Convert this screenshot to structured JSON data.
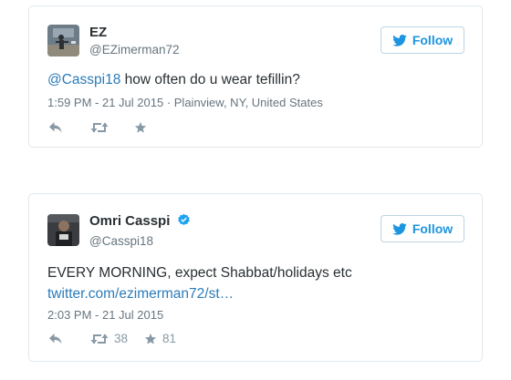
{
  "tweets": [
    {
      "name": "EZ",
      "handle": "@EZimerman72",
      "follow_label": "Follow",
      "mention": "@Casspi18",
      "body": " how often do u wear tefillin?",
      "timestamp": "1:59 PM - 21 Jul 2015",
      "separator": " · ",
      "location": "Plainview, NY, United States",
      "retweet_count": "",
      "favorite_count": ""
    },
    {
      "name": "Omri Casspi",
      "verified": true,
      "handle": "@Casspi18",
      "follow_label": "Follow",
      "body": "EVERY MORNING, expect Shabbat/holidays etc",
      "link": "twitter.com/ezimerman72/st…",
      "timestamp": "2:03 PM - 21 Jul 2015",
      "retweet_count": "38",
      "favorite_count": "81"
    }
  ],
  "colors": {
    "link": "#2b7bb9",
    "follow": "#1b95e0",
    "verified": "#1da1f2",
    "muted": "#66757f",
    "icon": "#8899a6"
  },
  "icons": [
    "twitter-bird-icon",
    "reply-icon",
    "retweet-icon",
    "favorite-star-icon",
    "verified-badge-icon"
  ]
}
